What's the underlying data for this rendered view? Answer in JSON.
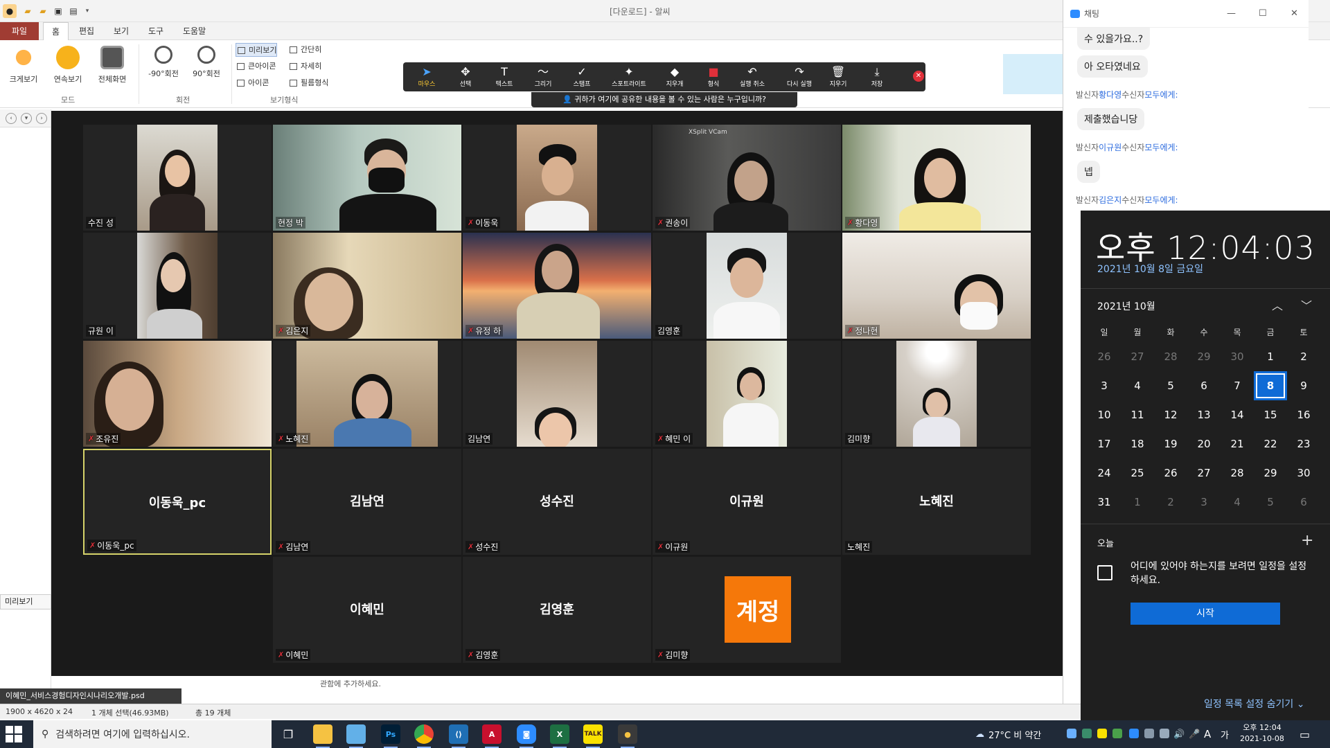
{
  "app": {
    "title": "[다운로드] - 알씨",
    "menus": [
      "파일",
      "홈",
      "편집",
      "보기",
      "도구",
      "도움말"
    ],
    "ribbon": {
      "items": [
        "크게보기",
        "연속보기",
        "전체화면",
        "-90°회전",
        "90°회전"
      ],
      "groups": [
        "모드",
        "회전",
        "보기형식"
      ],
      "view_options": [
        "미리보기",
        "간단히",
        "큰아이콘",
        "자세히",
        "아이콘",
        "필름형식"
      ]
    },
    "left_nav": {
      "preview_tab": "미리보기"
    },
    "status": {
      "file": "이혜민_서비스경험디자인시나리오개발.psd",
      "dimensions": "1900 x 4620 x 24",
      "selection": "1 개체 선택(46.93MB)",
      "total": "총 19 개체"
    },
    "hint": "관함에 추가하세요."
  },
  "zoom": {
    "annotation_tools": [
      "마우스",
      "선택",
      "텍스트",
      "그리기",
      "스탬프",
      "스포트라이트",
      "지우개",
      "형식",
      "실행 취소",
      "다시 실행",
      "지우기",
      "저장"
    ],
    "share_question": "귀하가 여기에 공유한 내용을 볼 수 있는 사람은 누구입니까?",
    "xsplit_label": "XSplit VCam",
    "video_tiles": [
      {
        "name": "수진 성",
        "muted": false
      },
      {
        "name": "현정 박",
        "muted": false
      },
      {
        "name": "이동욱",
        "muted": true
      },
      {
        "name": "권송이",
        "muted": true
      },
      {
        "name": "황다영",
        "muted": true
      },
      {
        "name": "규원 이",
        "muted": false
      },
      {
        "name": "김은지",
        "muted": true
      },
      {
        "name": "유정 하",
        "muted": true
      },
      {
        "name": "김영훈",
        "muted": false
      },
      {
        "name": "정나현",
        "muted": true
      },
      {
        "name": "조유진",
        "muted": true
      },
      {
        "name": "노혜진",
        "muted": true
      },
      {
        "name": "김남연",
        "muted": false
      },
      {
        "name": "혜민 이",
        "muted": true
      },
      {
        "name": "김미향",
        "muted": false
      }
    ],
    "name_tiles": [
      {
        "center": "이동욱_pc",
        "name": "이동욱_pc",
        "muted": true
      },
      {
        "center": "김남연",
        "name": "김남연",
        "muted": true
      },
      {
        "center": "성수진",
        "name": "성수진",
        "muted": true
      },
      {
        "center": "이규원",
        "name": "이규원",
        "muted": true
      },
      {
        "center": "노혜진",
        "name": "노혜진",
        "muted": false
      },
      {
        "center": "이혜민",
        "name": "이혜민",
        "muted": true
      },
      {
        "center": "김영훈",
        "name": "김영훈",
        "muted": true
      },
      {
        "avatar": "계정",
        "name": "김미향",
        "muted": true
      }
    ]
  },
  "chat": {
    "title": "채팅",
    "messages": [
      {
        "type": "bubble",
        "text": "수 있을가요..?"
      },
      {
        "type": "bubble",
        "text": "아 오타였네요"
      },
      {
        "type": "sender",
        "prefix": "발신자",
        "from": "황다영",
        "mid": "수신자",
        "to": "모두에게:"
      },
      {
        "type": "bubble",
        "text": "제출했습니당"
      },
      {
        "type": "sender",
        "prefix": "발신자",
        "from": "이규원",
        "mid": "수신자",
        "to": "모두에게:"
      },
      {
        "type": "bubble",
        "text": "넵"
      },
      {
        "type": "sender",
        "prefix": "발신자",
        "from": "김은지",
        "mid": "수신자",
        "to": "모두에게:"
      }
    ]
  },
  "calendar": {
    "time": "오후 12:04:03",
    "date": "2021년 10월 8일 금요일",
    "month_label": "2021년 10월",
    "weekdays": [
      "일",
      "월",
      "화",
      "수",
      "목",
      "금",
      "토"
    ],
    "weeks": [
      [
        [
          "26",
          1
        ],
        [
          "27",
          1
        ],
        [
          "28",
          1
        ],
        [
          "29",
          1
        ],
        [
          "30",
          1
        ],
        [
          "1",
          0
        ],
        [
          "2",
          0
        ]
      ],
      [
        [
          "3",
          0
        ],
        [
          "4",
          0
        ],
        [
          "5",
          0
        ],
        [
          "6",
          0
        ],
        [
          "7",
          0
        ],
        [
          "8",
          2
        ],
        [
          "9",
          0
        ]
      ],
      [
        [
          "10",
          0
        ],
        [
          "11",
          0
        ],
        [
          "12",
          0
        ],
        [
          "13",
          0
        ],
        [
          "14",
          0
        ],
        [
          "15",
          0
        ],
        [
          "16",
          0
        ]
      ],
      [
        [
          "17",
          0
        ],
        [
          "18",
          0
        ],
        [
          "19",
          0
        ],
        [
          "20",
          0
        ],
        [
          "21",
          0
        ],
        [
          "22",
          0
        ],
        [
          "23",
          0
        ]
      ],
      [
        [
          "24",
          0
        ],
        [
          "25",
          0
        ],
        [
          "26",
          0
        ],
        [
          "27",
          0
        ],
        [
          "28",
          0
        ],
        [
          "29",
          0
        ],
        [
          "30",
          0
        ]
      ],
      [
        [
          "31",
          0
        ],
        [
          "1",
          1
        ],
        [
          "2",
          1
        ],
        [
          "3",
          1
        ],
        [
          "4",
          1
        ],
        [
          "5",
          1
        ],
        [
          "6",
          1
        ]
      ]
    ],
    "today_label": "오늘",
    "event_text": "어디에 있어야 하는지를 보려면 일정을 설정하세요.",
    "start_button": "시작",
    "hide_link": "일정 목록 설정 숨기기"
  },
  "taskbar": {
    "search_placeholder": "검색하려면 여기에 입력하십시오.",
    "weather": "27°C  비 약간",
    "time": "오후 12:04",
    "date": "2021-10-08",
    "ime": "A",
    "ime2": "가"
  }
}
